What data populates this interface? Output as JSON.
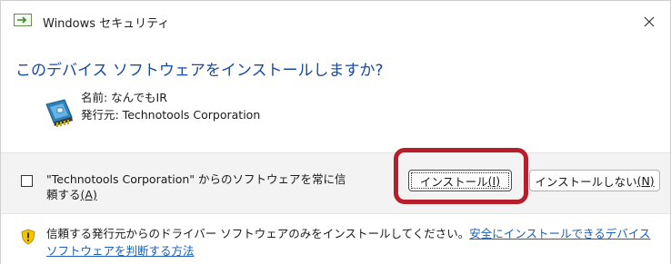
{
  "window": {
    "title": "Windows セキュリティ"
  },
  "heading": "このデバイス ソフトウェアをインストールしますか?",
  "device": {
    "name_line": "名前: なんでもIR",
    "publisher_line": "発行元: Technotools Corporation"
  },
  "trust_checkbox": {
    "label": "\"Technotools Corporation\" からのソフトウェアを常に信頼する",
    "accel": "(A)",
    "checked": false
  },
  "buttons": {
    "install_label": "インストール",
    "install_accel": "(I)",
    "dont_install_label": "インストールしない",
    "dont_install_accel": "(N)"
  },
  "footer": {
    "notice": "信頼する発行元からのドライバー ソフトウェアのみをインストールしてください。",
    "link": "安全にインストールできるデバイス ソフトウェアを判断する方法"
  },
  "colors": {
    "heading": "#1a4aa0",
    "link": "#1a5fb4",
    "highlight": "#b51e2a",
    "shield": "#f2c300"
  },
  "icons": {
    "title": "security-app-icon",
    "close": "close-icon",
    "device": "device-card-icon",
    "warning": "warning-shield-icon"
  }
}
